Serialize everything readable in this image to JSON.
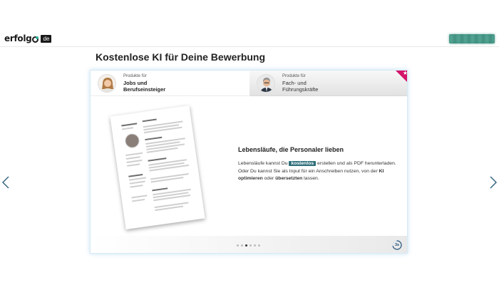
{
  "header": {
    "logo_text": "erfolg",
    "logo_tld": "de",
    "cta_icon": "blurred-button"
  },
  "page_title": "Kostenlose KI für Deine Bewerbung",
  "tabs": [
    {
      "small": "Produkte für",
      "label": "Jobs und\nBerufseinsteiger",
      "active": true,
      "avatar": "woman-avatar"
    },
    {
      "small": "Produkte für",
      "label": "Fach- und\nFührungskräfte",
      "active": false,
      "avatar": "man-avatar"
    }
  ],
  "slide": {
    "title": "Lebensläufe, die Personaler lieben",
    "body_1": "Lebensläufe kannst Du ",
    "highlight": "kostenlos",
    "body_2": " erstellen und als PDF herunterladen. Oder Du kannst Sie als Input für ein Anschreiben nutzen, von der ",
    "bold_1": "KI optimieren",
    "body_3": " oder ",
    "bold_2": "übersetzten",
    "body_4": " lassen."
  },
  "carousel": {
    "slide_count": 6,
    "active_index": 2,
    "timer_label": "3s",
    "timer_progress": 0.7
  },
  "colors": {
    "accent_teal": "#2f6f7a",
    "brand_green": "#3d8d7d",
    "corner_pink": "#d4146b",
    "timer_blue": "#1d4f7a"
  }
}
